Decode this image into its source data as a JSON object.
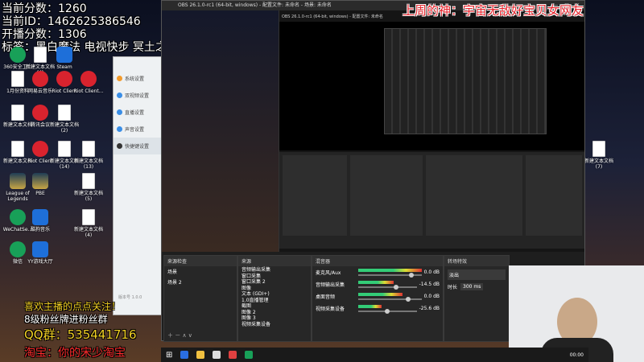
{
  "overlay": {
    "current_score": "当前分数：1260",
    "current_id": "当前ID：1462625386546",
    "start_score": "开播分数：1306",
    "win_tag": "标签：黑白魔法 电视快步 冥土之活络潮",
    "banner_right": "上周的神：宇宙无敌好宝贝女网友",
    "qq_group": "QQ群：535441716",
    "follow_prompt": "喜欢主播的点点关注！",
    "group_prompt": "8级粉丝牌进粉丝群",
    "shop_prompt": "淘宝：你的宋少淘宝"
  },
  "desktop": {
    "icons": [
      {
        "label": "360安全卫士",
        "icon": "shield-icon"
      },
      {
        "label": "新建文本文档 (4)",
        "icon": "document-icon"
      },
      {
        "label": "Steam",
        "icon": "steam-icon"
      },
      {
        "label": "1月份资料",
        "icon": "document-icon"
      },
      {
        "label": "网易云音乐",
        "icon": "music-icon"
      },
      {
        "label": "Riot Client",
        "icon": "riot-icon"
      },
      {
        "label": "Riot Client...",
        "icon": "riot-icon"
      },
      {
        "label": "新建文本文档",
        "icon": "document-icon"
      },
      {
        "label": "腾讯会议",
        "icon": "meeting-icon"
      },
      {
        "label": "新建文本文档 (2)",
        "icon": "document-icon"
      },
      {
        "label": "新建文本文档",
        "icon": "document-icon"
      },
      {
        "label": "Riot Client",
        "icon": "riot-icon"
      },
      {
        "label": "新建文本文档 (14)",
        "icon": "document-icon"
      },
      {
        "label": "新建文本文档 (13)",
        "icon": "document-icon"
      },
      {
        "label": "League of Legends",
        "icon": "lol-icon"
      },
      {
        "label": "PBE",
        "icon": "lol-icon"
      },
      {
        "label": "WeChatSe...",
        "icon": "wechat-icon"
      },
      {
        "label": "酷狗音乐",
        "icon": "music-icon"
      },
      {
        "label": "新建文本文档 (4)",
        "icon": "document-icon"
      },
      {
        "label": "微信",
        "icon": "wechat-icon"
      },
      {
        "label": "YY游戏大厅",
        "icon": "game-icon"
      },
      {
        "label": "新建文本文档 (5)",
        "icon": "document-icon"
      },
      {
        "label": "新建文本文档 (7)",
        "icon": "document-icon"
      }
    ]
  },
  "settings_window": {
    "items": [
      "系统设置",
      "双视频设置",
      "直播设置",
      "声音设置",
      "快捷键设置"
    ],
    "footer": "版本号 1.0.0"
  },
  "obs": {
    "title": "OBS 26.1.0-rc1 (64-bit, windows) - 配置文件: 未命名 - 场景: 未命名",
    "preview_title": "OBS 26.1.0-rc1 (64-bit, windows) - 配置文件: 未命名",
    "scenes_header": "来源检查",
    "scenes": [
      "场景",
      "场景 2"
    ],
    "sources_header": "来源",
    "sources": [
      "音频输出采集",
      "窗口采集",
      "窗口采集 2",
      "图像",
      "文本 (GDI+)",
      "1.0直播管理",
      "截图",
      "图像 2",
      "图像 3",
      "视频采集设备"
    ],
    "mixer_header": "混音器",
    "mixer": [
      {
        "label": "麦克风/Aux",
        "db": "0.0 dB"
      },
      {
        "label": "音频输出采集",
        "db": "-14.5 dB"
      },
      {
        "label": "桌面音频",
        "db": "0.0 dB"
      },
      {
        "label": "视频采集设备",
        "db": "-25.6 dB"
      }
    ],
    "transitions_header": "转场特效",
    "transition_select": "淡出",
    "duration_label": "时长",
    "duration": "300 ms"
  },
  "taskbar": {
    "time": "00:00"
  },
  "colors": {
    "banner_red": "#e6232b",
    "overlay_yellow": "#f2d024",
    "overlay_red": "#ff2d2d"
  }
}
